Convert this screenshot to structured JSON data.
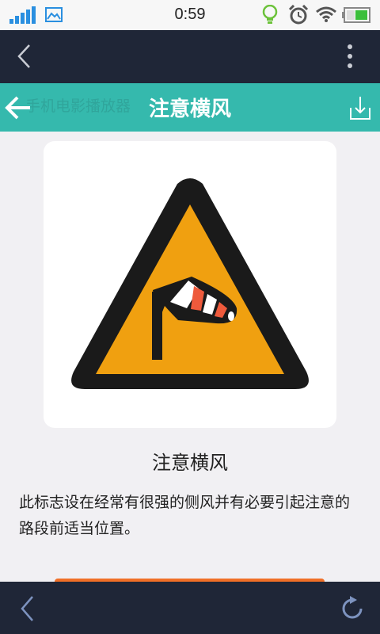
{
  "status_bar": {
    "time": "0:59"
  },
  "app_bar": {
    "ghost_text": "手机电影播放器",
    "title": "注意横风"
  },
  "sign": {
    "name": "注意横风",
    "description": "此标志设在经常有很强的侧风并有必要引起注意的路段前适当位置。"
  },
  "colors": {
    "status_bar_bg": "#f7f7f7",
    "browser_bar_bg": "#1f2637",
    "app_bar_bg": "#35b9ad",
    "sign_fill": "#f0a010",
    "sign_border": "#1a1a1a",
    "sock_stripe": "#ee5a3c",
    "action_button": "#f06f27"
  },
  "icons": {
    "signal": "signal-strength-icon",
    "image": "image-notification-icon",
    "lightbulb": "lightbulb-icon",
    "alarm": "alarm-clock-icon",
    "wifi": "wifi-icon",
    "battery": "battery-icon",
    "browser_back": "chevron-left-icon",
    "browser_menu": "more-vertical-icon",
    "app_back": "arrow-left-icon",
    "download": "download-icon",
    "bottom_back": "chevron-left-icon",
    "refresh": "refresh-icon"
  }
}
